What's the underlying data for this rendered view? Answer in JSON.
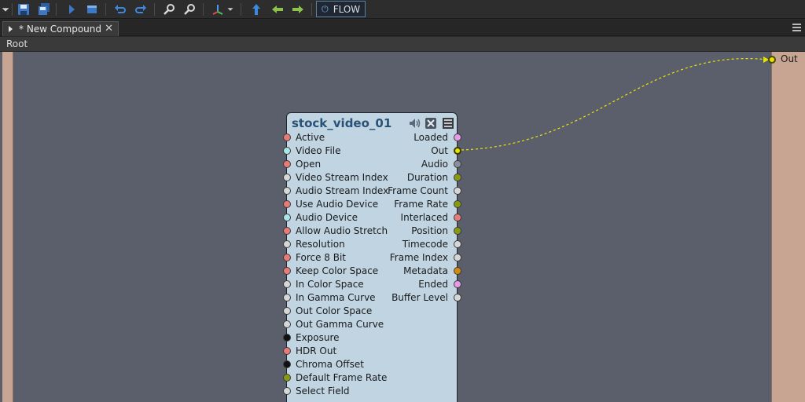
{
  "toolbar": {
    "buttons": [
      {
        "name": "dropdown-arrow",
        "icon": "chevron-down-icon"
      },
      {
        "name": "save",
        "icon": "save-icon"
      },
      {
        "name": "save-all",
        "icon": "save-all-icon"
      },
      {
        "name": "run",
        "icon": "play-icon"
      },
      {
        "name": "stop",
        "icon": "stop-icon"
      },
      {
        "name": "undo",
        "icon": "undo-icon"
      },
      {
        "name": "redo",
        "icon": "redo-icon"
      },
      {
        "name": "zoom-in",
        "icon": "zoom-in-icon"
      },
      {
        "name": "zoom-out",
        "icon": "zoom-out-icon"
      },
      {
        "name": "layout",
        "icon": "layout-icon"
      },
      {
        "name": "up-level",
        "icon": "up-arrow-icon"
      },
      {
        "name": "back",
        "icon": "arrow-left-icon"
      },
      {
        "name": "forward",
        "icon": "arrow-right-icon"
      }
    ],
    "flow_label": "FLOW"
  },
  "tab": {
    "title": "* New Compound",
    "close": "✕"
  },
  "breadcrumb": "Root",
  "rail": {
    "out_label": "Out"
  },
  "node": {
    "title": "stock_video_01",
    "inputs": [
      {
        "label": "Active",
        "color": "#e87b78"
      },
      {
        "label": "Video File",
        "color": "#a9e6ea"
      },
      {
        "label": "Open",
        "color": "#e87b78"
      },
      {
        "label": "Video Stream Index",
        "color": "#d6d6d6"
      },
      {
        "label": "Audio Stream Index",
        "color": "#d6d6d6"
      },
      {
        "label": "Use Audio Device",
        "color": "#e87b78"
      },
      {
        "label": "Audio Device",
        "color": "#a9e6ea"
      },
      {
        "label": "Allow Audio Stretch",
        "color": "#e87b78"
      },
      {
        "label": "Resolution",
        "color": "#d6d6d6"
      },
      {
        "label": "Force 8 Bit",
        "color": "#e87b78"
      },
      {
        "label": "Keep Color Space",
        "color": "#e87b78"
      },
      {
        "label": "In Color Space",
        "color": "#d6d6d6"
      },
      {
        "label": "In Gamma Curve",
        "color": "#d6d6d6"
      },
      {
        "label": "Out Color Space",
        "color": "#d6d6d6"
      },
      {
        "label": "Out Gamma Curve",
        "color": "#d6d6d6"
      },
      {
        "label": "Exposure",
        "color": "#111111"
      },
      {
        "label": "HDR Out",
        "color": "#e87b78"
      },
      {
        "label": "Chroma Offset",
        "color": "#111111"
      },
      {
        "label": "Default Frame Rate",
        "color": "#8a9a10"
      },
      {
        "label": "Select Field",
        "color": "#d6d6d6"
      }
    ],
    "outputs": [
      {
        "label": "Loaded",
        "color": "#e79ae6"
      },
      {
        "label": "Out",
        "color": "#e8e600"
      },
      {
        "label": "Audio",
        "color": "#8a8f9e"
      },
      {
        "label": "Duration",
        "color": "#8a9a10"
      },
      {
        "label": "Frame Count",
        "color": "#d6d6d6"
      },
      {
        "label": "Frame Rate",
        "color": "#8a9a10"
      },
      {
        "label": "Interlaced",
        "color": "#e87b78"
      },
      {
        "label": "Position",
        "color": "#8a9a10"
      },
      {
        "label": "Timecode",
        "color": "#d6d6d6"
      },
      {
        "label": "Frame Index",
        "color": "#d6d6d6"
      },
      {
        "label": "Metadata",
        "color": "#d08a10"
      },
      {
        "label": "Ended",
        "color": "#e79ae6"
      },
      {
        "label": "Buffer Level",
        "color": "#d6d6d6"
      }
    ]
  }
}
